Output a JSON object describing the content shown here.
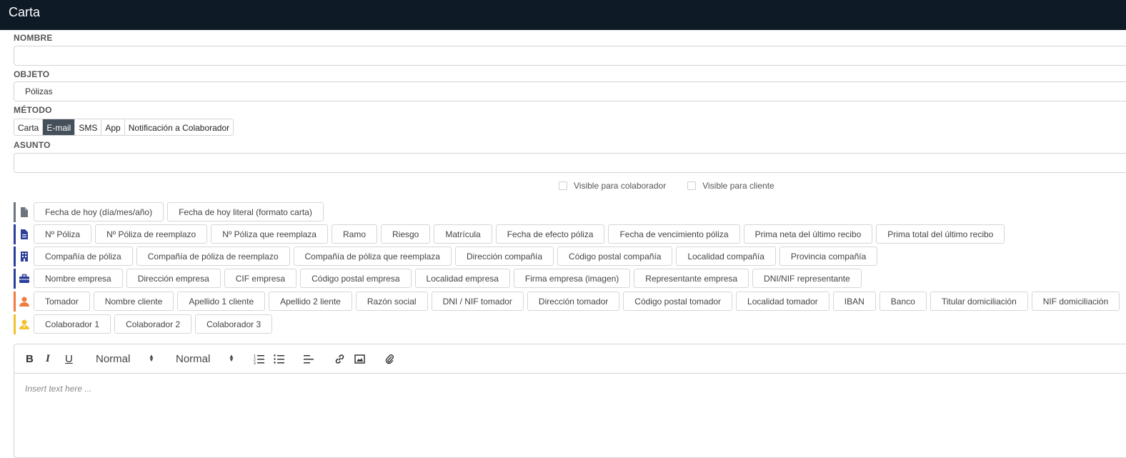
{
  "window": {
    "title": "Carta"
  },
  "form": {
    "nombre": {
      "label": "NOMBRE",
      "value": ""
    },
    "objeto": {
      "label": "OBJETO",
      "value": "Pólizas"
    },
    "metodo": {
      "label": "MÉTODO",
      "options": [
        "Carta",
        "E-mail",
        "SMS",
        "App",
        "Notificación a Colaborador"
      ],
      "selected": "E-mail"
    },
    "asunto": {
      "label": "ASUNTO",
      "value": ""
    },
    "visible_colaborador": "Visible para colaborador",
    "visible_cliente": "Visible para cliente"
  },
  "variable_groups": [
    {
      "icon": "document-icon",
      "color": "#6c757d",
      "tags": [
        "Fecha de hoy (día/mes/año)",
        "Fecha de hoy literal (formato carta)"
      ]
    },
    {
      "icon": "policy-document-icon",
      "color": "#2c3e9a",
      "tags": [
        "Nº Póliza",
        "Nº Póliza de reemplazo",
        "Nº Póliza que reemplaza",
        "Ramo",
        "Riesgo",
        "Matrícula",
        "Fecha de efecto póliza",
        "Fecha de vencimiento póliza",
        "Prima neta del último recibo",
        "Prima total del último recibo"
      ]
    },
    {
      "icon": "building-icon",
      "color": "#2c3e9a",
      "tags": [
        "Compañía de póliza",
        "Compañía de póliza de reemplazo",
        "Compañía de póliza que reemplaza",
        "Dirección compañía",
        "Código postal compañía",
        "Localidad compañía",
        "Provincia compañía"
      ]
    },
    {
      "icon": "briefcase-icon",
      "color": "#2c3e9a",
      "tags": [
        "Nombre empresa",
        "Dirección empresa",
        "CIF empresa",
        "Código postal empresa",
        "Localidad empresa",
        "Firma empresa (imagen)",
        "Representante empresa",
        "DNI/NIF representante"
      ]
    },
    {
      "icon": "user-icon",
      "color": "#f07b3f",
      "tags": [
        "Tomador",
        "Nombre cliente",
        "Apellido 1 cliente",
        "Apellido 2 liente",
        "Razón social",
        "DNI / NIF tomador",
        "Dirección tomador",
        "Código postal tomador",
        "Localidad tomador",
        "IBAN",
        "Banco",
        "Titular domiciliación",
        "NIF domiciliación"
      ]
    },
    {
      "icon": "collaborator-icon",
      "color": "#f2c12e",
      "tags": [
        "Colaborador 1",
        "Colaborador 2",
        "Colaborador 3"
      ]
    }
  ],
  "editor": {
    "toolbar": {
      "bold": "B",
      "italic": "I",
      "underline": "U",
      "font_size": "Normal",
      "heading": "Normal"
    },
    "placeholder": "Insert text here ..."
  }
}
